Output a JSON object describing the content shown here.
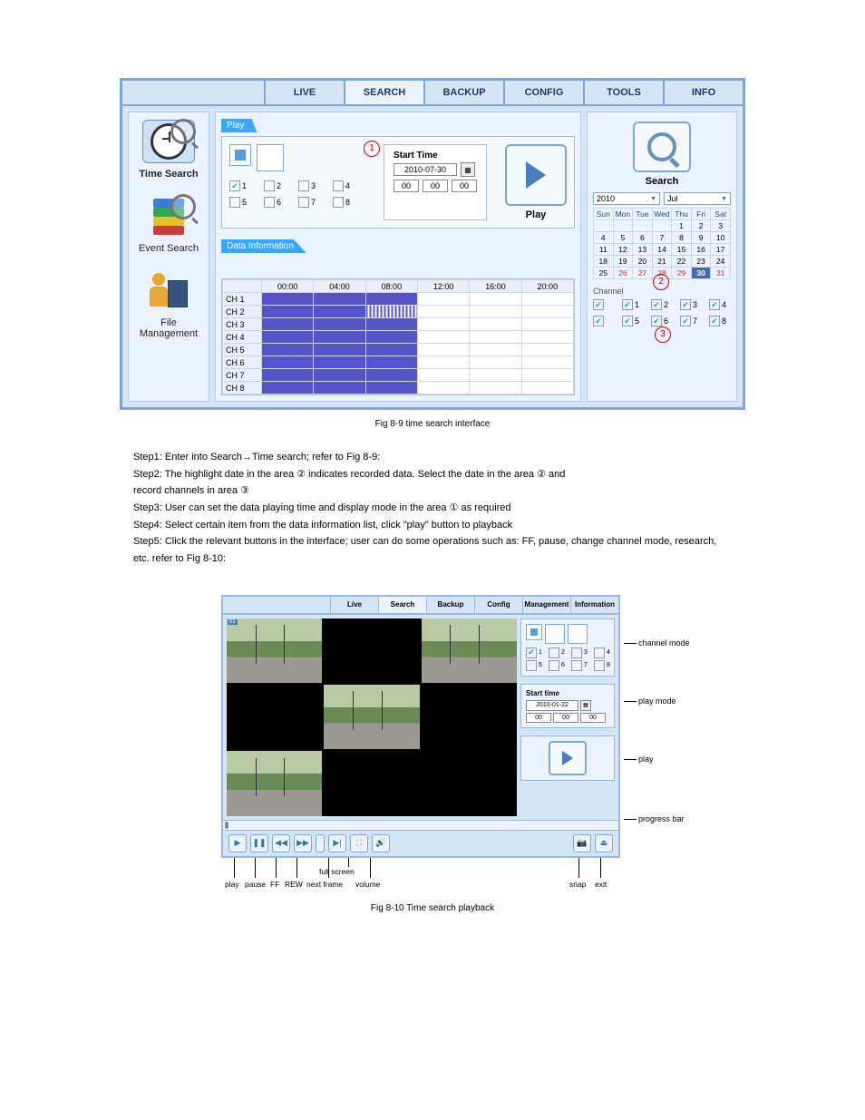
{
  "fig1": {
    "tabs": [
      "LIVE",
      "SEARCH",
      "BACKUP",
      "CONFIG",
      "TOOLS",
      "INFO"
    ],
    "active_tab": "SEARCH",
    "sidebar": [
      {
        "label": "Time Search",
        "active": true
      },
      {
        "label": "Event Search",
        "active": false
      },
      {
        "label": "File Management",
        "active": false
      }
    ],
    "play_panel_title": "Play",
    "circled1": "1",
    "channels": [
      "1",
      "2",
      "3",
      "4",
      "5",
      "6",
      "7",
      "8"
    ],
    "channels_checked": [
      true,
      false,
      false,
      false,
      false,
      false,
      false,
      false
    ],
    "start_time": {
      "label": "Start Time",
      "date": "2010-07-30",
      "hh": "00",
      "mm": "00",
      "ss": "00"
    },
    "play_label": "Play",
    "datainfo_title": "Data Information",
    "time_headers": [
      "00:00",
      "04:00",
      "08:00",
      "12:00",
      "16:00",
      "20:00"
    ],
    "rows": [
      {
        "label": "CH 1",
        "f": [
          1,
          1,
          1,
          0,
          0,
          0
        ]
      },
      {
        "label": "CH 2",
        "f": [
          1,
          1,
          2,
          0,
          0,
          0
        ]
      },
      {
        "label": "CH 3",
        "f": [
          1,
          1,
          1,
          0,
          0,
          0
        ]
      },
      {
        "label": "CH 4",
        "f": [
          1,
          1,
          1,
          0,
          0,
          0
        ]
      },
      {
        "label": "CH 5",
        "f": [
          1,
          1,
          1,
          0,
          0,
          0
        ]
      },
      {
        "label": "CH 6",
        "f": [
          1,
          1,
          1,
          0,
          0,
          0
        ]
      },
      {
        "label": "CH 7",
        "f": [
          1,
          1,
          1,
          0,
          0,
          0
        ]
      },
      {
        "label": "CH 8",
        "f": [
          1,
          1,
          1,
          0,
          0,
          0
        ]
      }
    ],
    "search_label": "Search",
    "year": "2010",
    "month": "Jul",
    "dow": [
      "Sun",
      "Mon",
      "Tue",
      "Wed",
      "Thu",
      "Fri",
      "Sat"
    ],
    "calendar_weeks": [
      [
        "",
        "",
        "",
        "",
        "1",
        "2",
        "3"
      ],
      [
        "4",
        "5",
        "6",
        "7",
        "8",
        "9",
        "10"
      ],
      [
        "11",
        "12",
        "13",
        "14",
        "15",
        "16",
        "17"
      ],
      [
        "18",
        "19",
        "20",
        "21",
        "22",
        "23",
        "24"
      ],
      [
        "25",
        "26",
        "27",
        "28",
        "29",
        "30",
        "31"
      ]
    ],
    "recorded_days": [
      "26",
      "27",
      "28",
      "29",
      "30",
      "31"
    ],
    "selected_day": "30",
    "circled2": "2",
    "channel_label": "Channel",
    "right_channels": [
      "1",
      "2",
      "3",
      "4",
      "5",
      "6",
      "7",
      "8"
    ],
    "circled3": "3"
  },
  "midtext": {
    "caption": "Fig 8-9 time search interface",
    "step1_pre": "Step1: Enter into Search→Time search; refer to Fig 8-9:",
    "step2_a": "Step2: The highlight date in the area",
    "step2_num": "②",
    "step2_b": " indicates recorded data. Select the date in the area",
    "step2_num2": "②",
    "step2_c": " and",
    "step3_a": "record channels in area",
    "step3_num": "③",
    "step3_b": "",
    "step3": "Step3: User can set the data playing time and display mode in the area",
    "step3_num_end": "①",
    "step3_c": " as required",
    "step4": "Step4: Select certain item from the data information list, click \"play\" button to playback",
    "step5": "Step5: Click the relevant buttons in the interface; user can do some operations such as: FF, pause, change channel mode, research, etc. refer to Fig 8-10:"
  },
  "fig2": {
    "tabs": [
      "Live",
      "Search",
      "Backup",
      "Config",
      "Management",
      "Information"
    ],
    "active_tab": "Search",
    "right": {
      "channels": [
        "1",
        "2",
        "3",
        "4",
        "5",
        "6",
        "7",
        "8"
      ],
      "channels_checked": [
        true,
        false,
        false,
        false,
        false,
        false,
        false,
        false
      ],
      "start_label": "Start time",
      "date": "2010-01-22",
      "hh": "00",
      "mm": "00",
      "ss": "00"
    },
    "tb_right": {
      "snap": "snap",
      "exit": "exit"
    },
    "annots": {
      "channel_mode": "channel mode",
      "play_mode": "play mode",
      "play": "play",
      "progress_bar": "progress bar"
    },
    "bottom": {
      "play": "play",
      "pause": "pause",
      "ff": "FF",
      "rew": "REW",
      "next_frame": "next frame",
      "full_screen": "full screen",
      "volume": "volume",
      "snap": "snap",
      "exit": "exit"
    },
    "caption": "Fig 8-10 Time search playback"
  }
}
